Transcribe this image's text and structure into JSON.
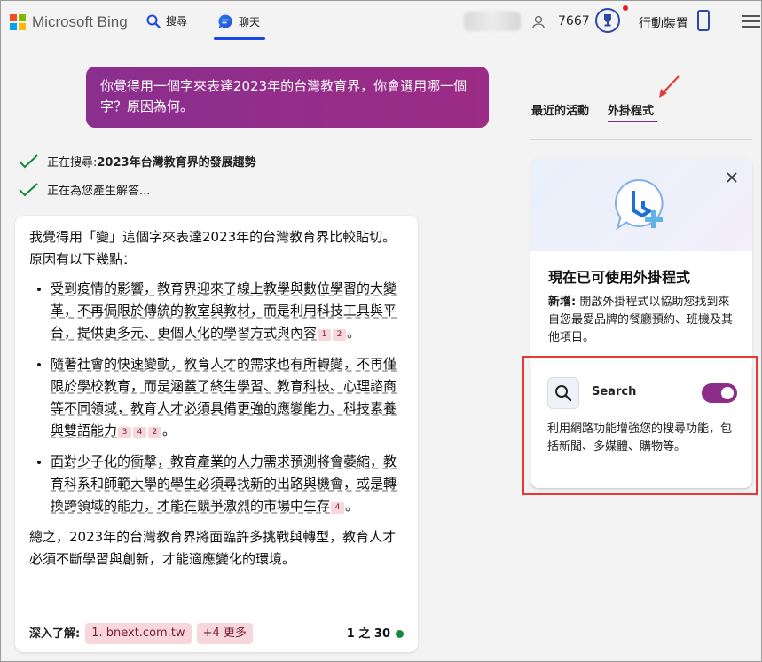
{
  "header": {
    "brand": "Microsoft Bing",
    "nav_search": "搜尋",
    "nav_chat": "聊天",
    "points": "7667",
    "mobile": "行動裝置",
    "logo_colors": [
      "#f25022",
      "#7fba00",
      "#00a4ef",
      "#ffb900"
    ]
  },
  "chat": {
    "user_message": "你覺得用一個字來表達2023年的台灣教育界，你會選用哪一個字？原因為何。",
    "status1_prefix": "正在搜尋: ",
    "status1_query": "2023年台灣教育界的發展趨勢",
    "status2": "正在為您產生解答...",
    "answer": {
      "intro": "我覺得用「變」這個字來表達2023年的台灣教育界比較貼切。原因有以下幾點：",
      "bullets": [
        {
          "text": "受到疫情的影響，教育界迎來了線上教學與數位學習的大變革，不再侷限於傳統的教室與教材，而是利用科技工具與平台，提供更多元、更個人化的學習方式與內容",
          "cites": [
            "1",
            "2"
          ]
        },
        {
          "text": "隨著社會的快速變動，教育人才的需求也有所轉變，不再僅限於學校教育，而是涵蓋了終生學習、教育科技、心理諮商等不同領域，教育人才必須具備更強的應變能力、科技素養與雙語能力",
          "cites": [
            "3",
            "4",
            "2"
          ]
        },
        {
          "text": "面對少子化的衝擊，教育產業的人力需求預測將會萎縮，教育科系和師範大學的學生必須尋找新的出路與機會，或是轉換跨領域的能力，才能在競爭激烈的市場中生存",
          "cites": [
            "4"
          ]
        }
      ],
      "summary": "總之，2023年的台灣教育界將面臨許多挑戰與轉型，教育人才必須不斷學習與創新，才能適應變化的環境。",
      "learn_more_label": "深入了解:",
      "source_chip": "1. bnext.com.tw",
      "more_chip": "+4 更多",
      "page_indicator": "1 之 30"
    }
  },
  "sidebar": {
    "tab_recent": "最近的活動",
    "tab_plugins": "外掛程式",
    "plugin_title": "現在已可使用外掛程式",
    "plugin_desc_bold": "新增:",
    "plugin_desc": " 開啟外掛程式以協助您找到來自您最愛品牌的餐廳預約、班機及其他項目。",
    "search_plugin_name": "Search",
    "search_plugin_enabled": true,
    "search_plugin_desc": "利用網路功能增強您的搜尋功能，包括新聞、多媒體、購物等。"
  }
}
